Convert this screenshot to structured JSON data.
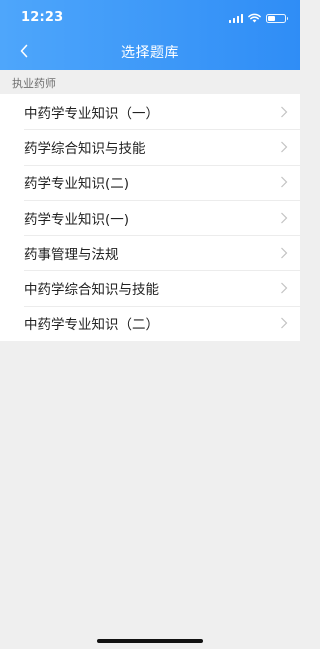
{
  "status_bar": {
    "time": "12:23"
  },
  "nav": {
    "title": "选择题库",
    "back_icon": "chevron-left-icon"
  },
  "section": {
    "label": "执业药师"
  },
  "items": [
    {
      "label": "中药学专业知识（一）"
    },
    {
      "label": "药学综合知识与技能"
    },
    {
      "label": "药学专业知识(二)"
    },
    {
      "label": "药学专业知识(一)"
    },
    {
      "label": "药事管理与法规"
    },
    {
      "label": "中药学综合知识与技能"
    },
    {
      "label": "中药学专业知识（二）"
    }
  ],
  "colors": {
    "header_start": "#4ea6fb",
    "header_end": "#2f8df6",
    "background": "#efefef"
  }
}
